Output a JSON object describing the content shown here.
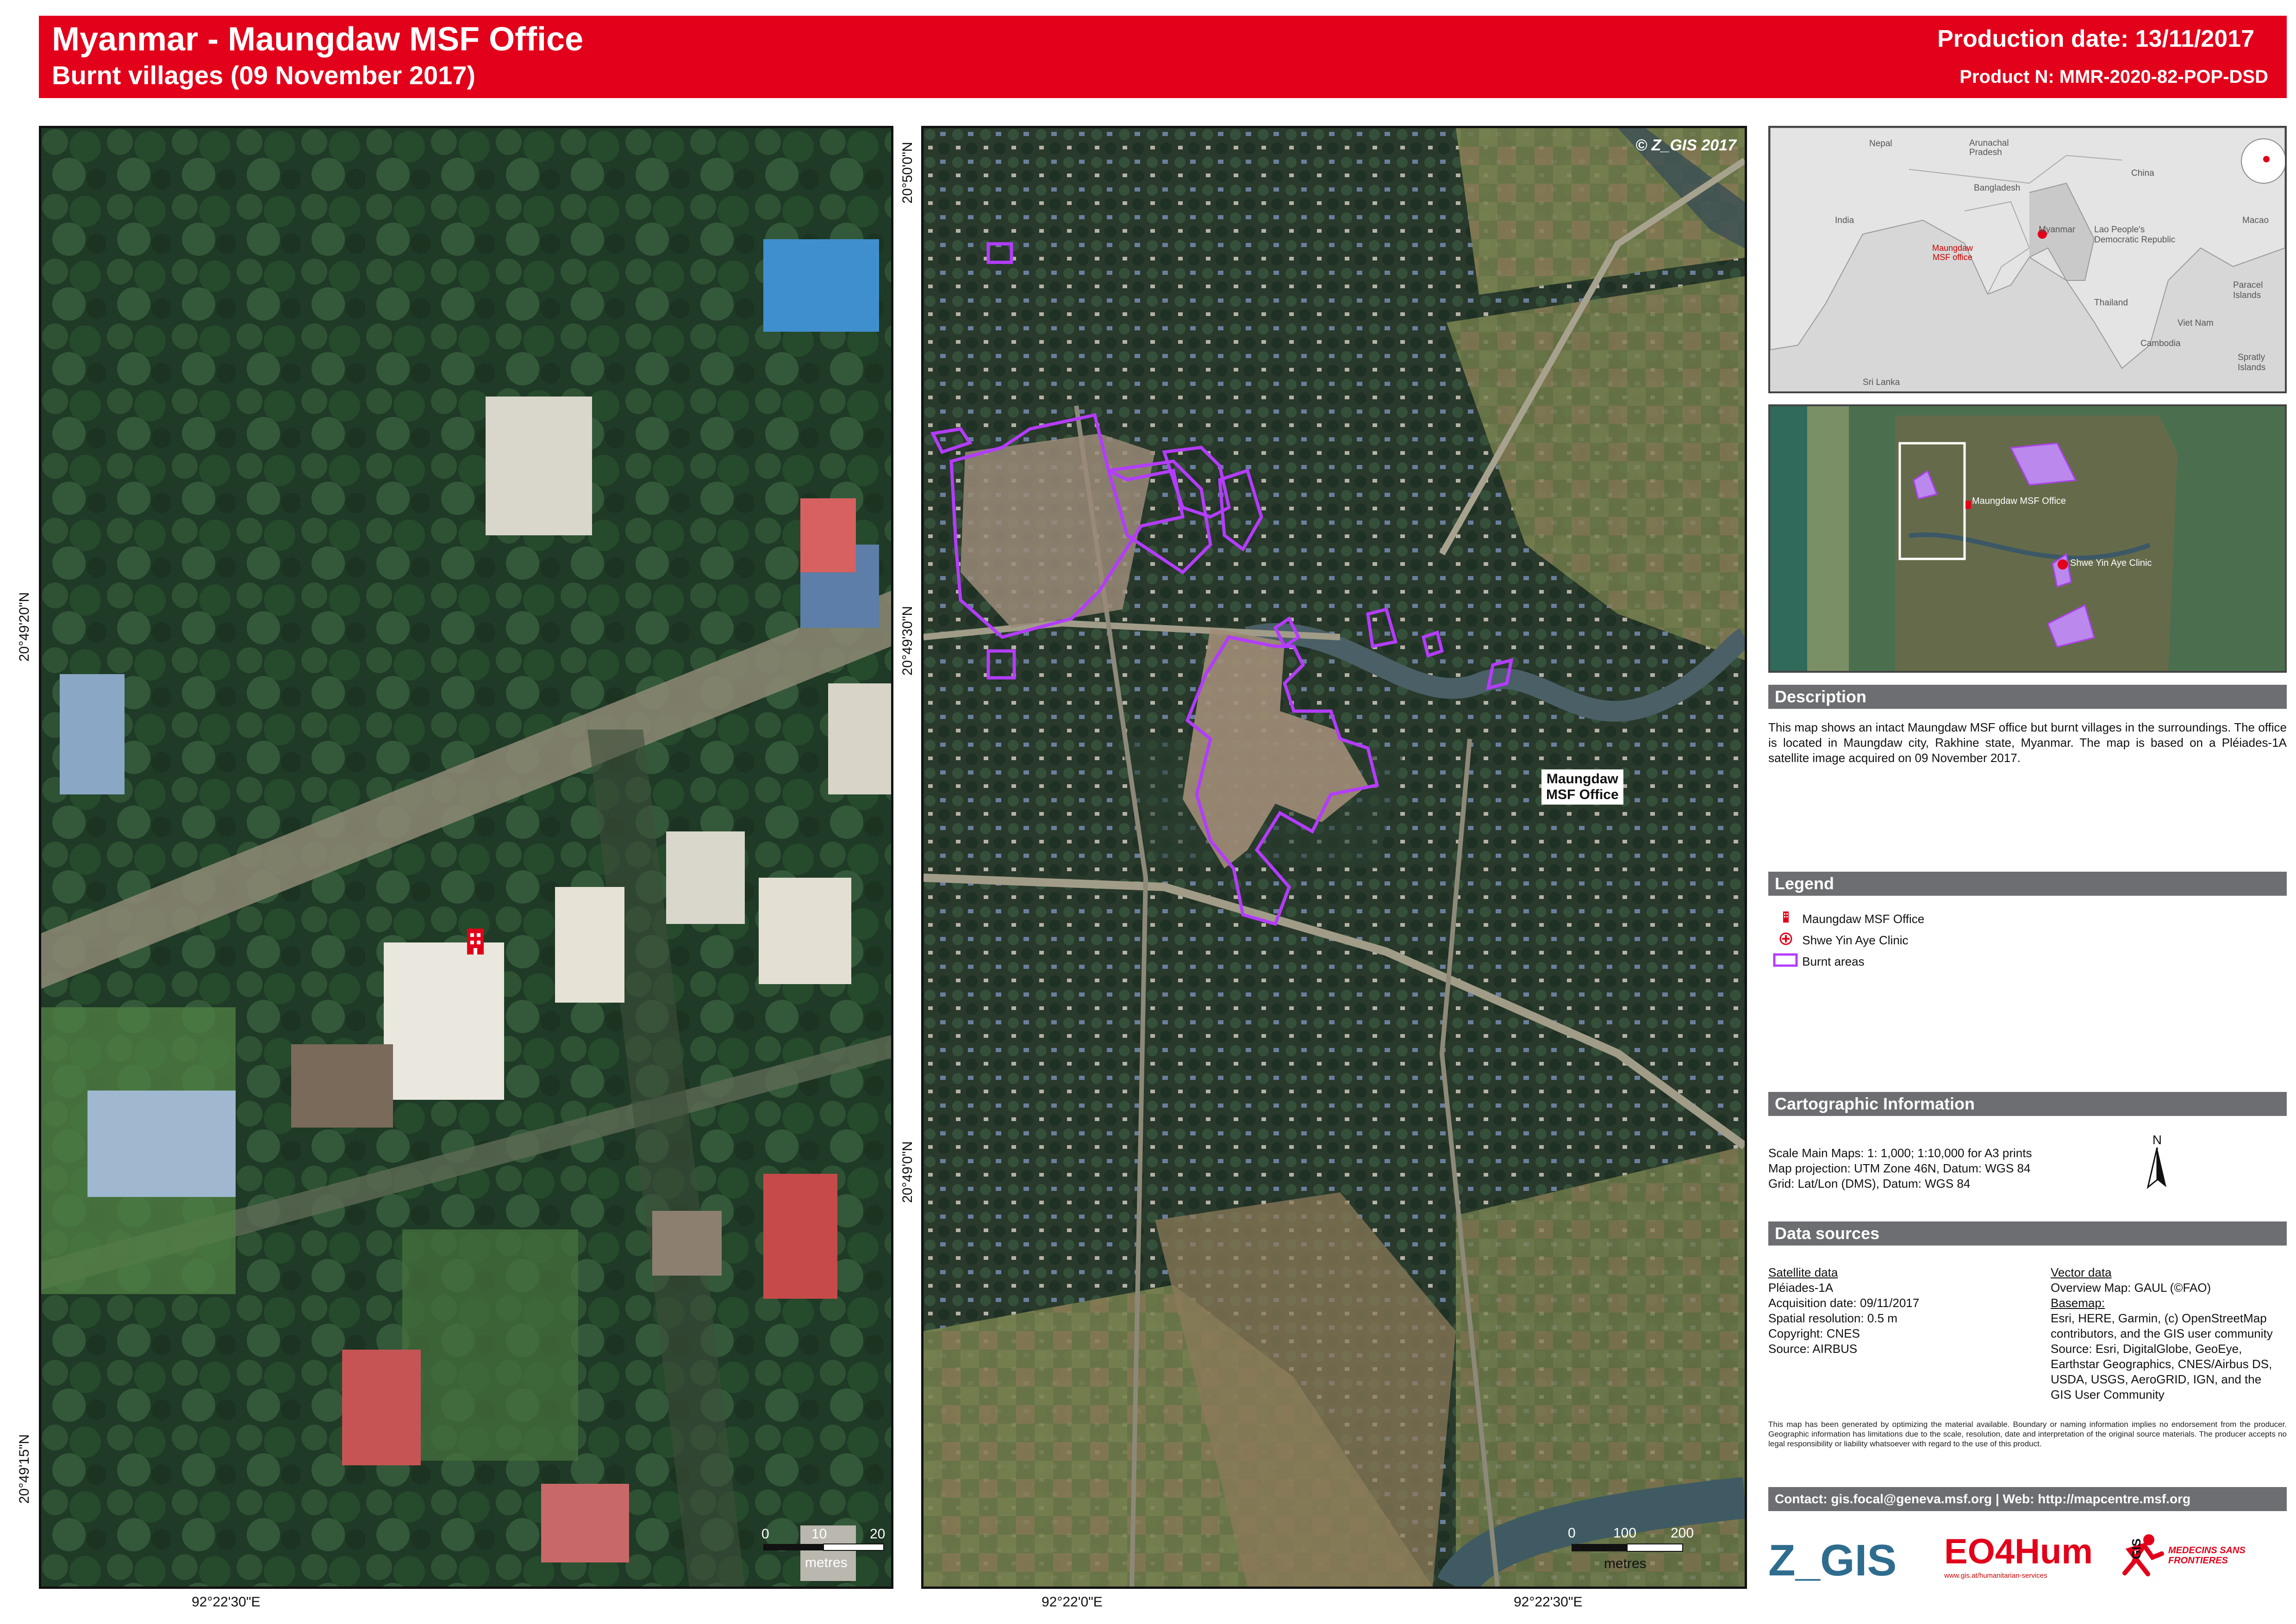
{
  "header": {
    "title": "Myanmar - Maungdaw MSF Office",
    "subtitle": "Burnt villages (09 November 2017)",
    "production_date": "Production date: 13/11/2017",
    "product_number": "Product N: MMR-2020-82-POP-DSD"
  },
  "left_map": {
    "lat_labels": [
      "20°49'20\"N",
      "20°49'15\"N"
    ],
    "lon_labels": [
      "92°22'30\"E"
    ],
    "scale_ticks": [
      "0",
      "10",
      "20"
    ],
    "scale_unit": "metres"
  },
  "main_map": {
    "copyright": "© Z_GIS 2017",
    "office_label_line1": "Maungdaw",
    "office_label_line2": "MSF Office",
    "lat_labels": [
      "20°50'0\"N",
      "20°49'30\"N",
      "20°49'0\"N"
    ],
    "lon_labels": [
      "92°22'0\"E",
      "92°22'30\"E"
    ],
    "scale_ticks": [
      "0",
      "100",
      "200"
    ],
    "scale_unit": "metres"
  },
  "overview_inset": {
    "labels": [
      "Nepal",
      "Arunachal Pradesh",
      "Bangladesh",
      "India",
      "China",
      "Myanmar",
      "Lao People's Democratic Republic",
      "Macao",
      "Thailand",
      "Viet Nam",
      "Cambodia",
      "Paracel Islands",
      "Spratly Islands",
      "Sri Lanka"
    ],
    "office_marker_label_line1": "Maungdaw",
    "office_marker_label_line2": "MSF office"
  },
  "zoom_inset": {
    "office_label": "Maungdaw MSF Office",
    "clinic_label": "Shwe Yin Aye Clinic"
  },
  "description": {
    "heading": "Description",
    "text": "This map shows an intact Maungdaw MSF office but burnt villages in the surroundings. The office is located in Maungdaw city, Rakhine state, Myanmar. The map is based on a Pléiades-1A satellite image acquired on 09 November 2017."
  },
  "legend": {
    "heading": "Legend",
    "items": [
      "Maungdaw MSF Office",
      "Shwe Yin Aye Clinic",
      "Burnt areas"
    ],
    "colors": {
      "office": "#e2001a",
      "clinic": "#e2001a",
      "burnt": "#b43cff"
    }
  },
  "cartographic": {
    "heading": "Cartographic Information",
    "lines": [
      "Scale Main Maps: 1: 1,000; 1:10,000 for A3 prints",
      "Map projection: UTM Zone 46N, Datum: WGS 84",
      "Grid: Lat/Lon (DMS), Datum: WGS 84"
    ],
    "north_label": "N"
  },
  "data_sources": {
    "heading": "Data sources",
    "satellite_heading": "Satellite data",
    "satellite_lines": [
      "Pléiades-1A",
      "Acquisition date: 09/11/2017",
      "Spatial resolution: 0.5 m",
      "Copyright: CNES",
      "Source: AIRBUS"
    ],
    "vector_heading": "Vector data",
    "vector_line": "Overview Map: GAUL (©FAO)",
    "basemap_heading": "Basemap:",
    "basemap_lines": [
      "Esri, HERE, Garmin, (c) OpenStreetMap",
      "contributors, and the GIS user community",
      "Source: Esri, DigitalGlobe, GeoEye,",
      "Earthstar Geographics, CNES/Airbus DS,",
      "USDA, USGS, AeroGRID, IGN, and the",
      "GIS User Community"
    ]
  },
  "disclaimer": "This map has been generated by optimizing the material available. Boundary or naming information implies no endorsement from the producer. Geographic information has limitations due to the scale, resolution, date and interpretation of the original source materials. The producer accepts no legal responsibility or liability whatsoever with regard to the use of this product.",
  "contact": "Contact: gis.focal@geneva.msf.org | Web: http://mapcentre.msf.org",
  "logos": {
    "zgis": "Z_GIS",
    "eo4hum": "EO4Hum",
    "eo4hum_url": "www.gis.at/humanitarian-services",
    "msf": "MEDECINS SANS FRONTIERES",
    "msf_gis": "GIS"
  },
  "colors": {
    "brand_red": "#e2001a",
    "section_grey": "#6d6e71",
    "burnt_outline": "#b43cff"
  }
}
